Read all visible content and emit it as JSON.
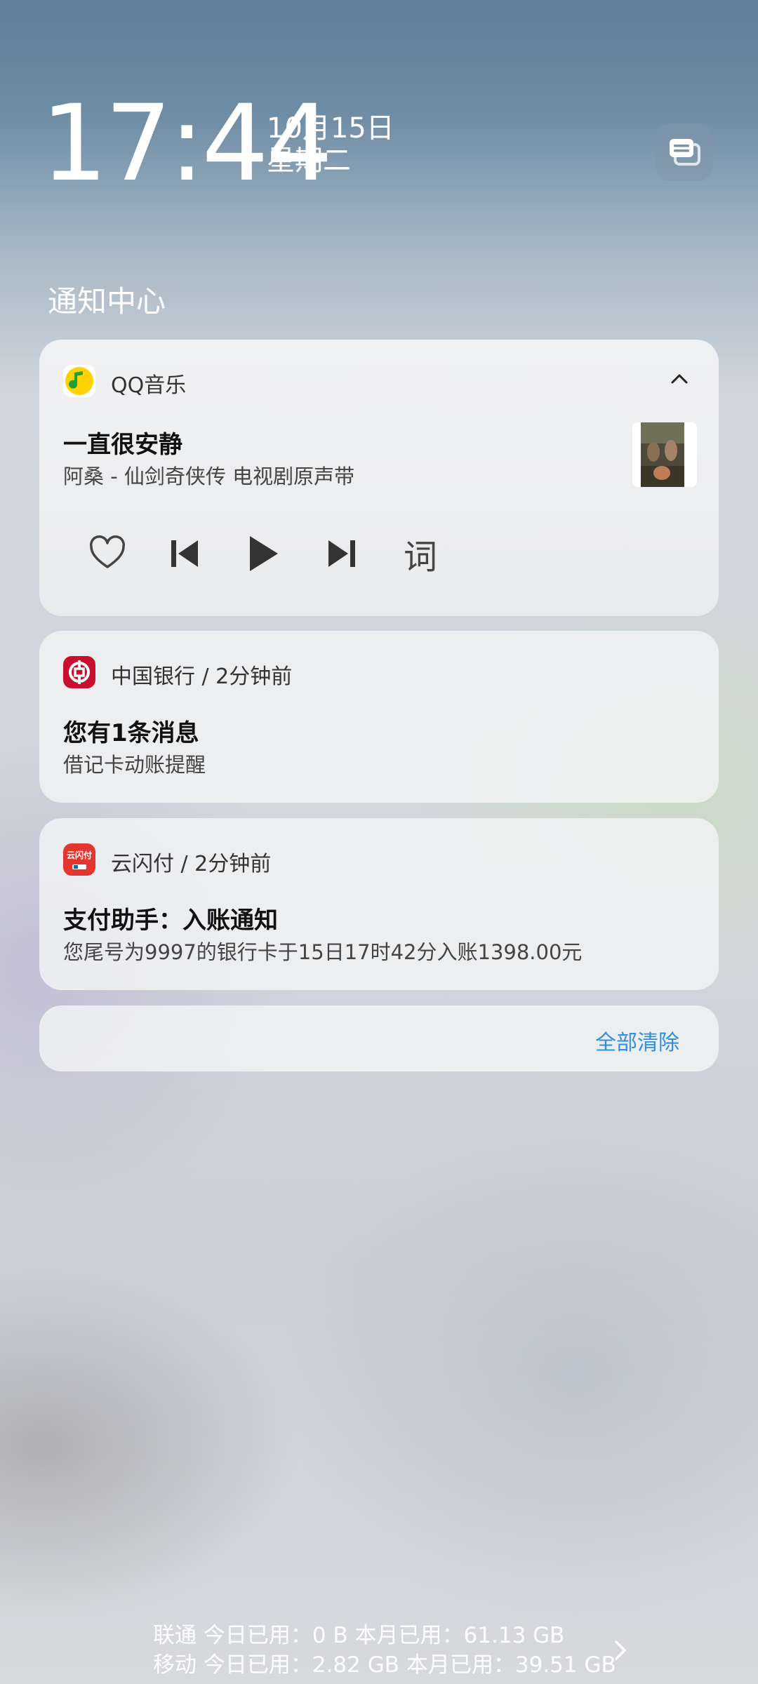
{
  "header": {
    "time": "17:44",
    "date": "10月15日",
    "weekday": "星期二",
    "title": "通知中心"
  },
  "music": {
    "app_name": "QQ音乐",
    "song": "一直很安静",
    "artist": "阿桑 - 仙剑奇侠传 电视剧原声带",
    "lyrics_label": "词"
  },
  "bank": {
    "header": "中国银行 / 2分钟前",
    "title": "您有1条消息",
    "body": "借记卡动账提醒"
  },
  "pay": {
    "header": "云闪付 / 2分钟前",
    "title": "支付助手：入账通知",
    "body": "您尾号为9997的银行卡于15日17时42分入账1398.00元",
    "icon_text": "云闪付"
  },
  "clear_all": "全部清除",
  "data_usage": {
    "line1": "联通 今日已用：0 B  本月已用：61.13 GB",
    "line2": "移动 今日已用：2.82 GB  本月已用：39.51 GB"
  },
  "colors": {
    "accent": "#2f8fe0",
    "boc_red": "#c8102e",
    "qq_yellow": "#ffd200"
  }
}
